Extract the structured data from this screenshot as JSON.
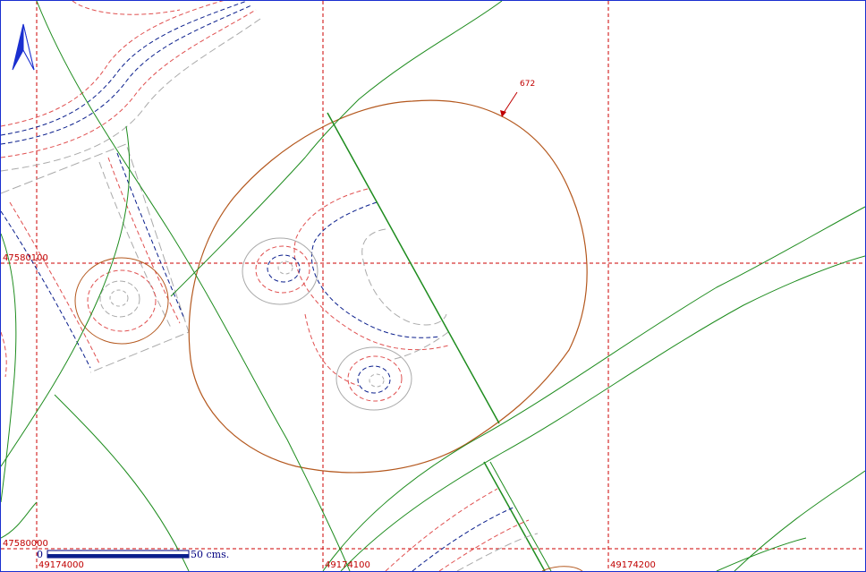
{
  "map": {
    "north_arrow_icon": "north-arrow-icon",
    "grid_labels": {
      "y_upper": "47580100",
      "y_lower": "47580000",
      "x_left": "49174000",
      "x_mid": "49174100",
      "x_right": "49174200"
    },
    "contour_label": "672",
    "scale_bar": {
      "start": "0",
      "end": "50 cms."
    },
    "colors": {
      "frame": "#1a2fd0",
      "grid": "#cc0000",
      "green_lines": "#1e8c1e",
      "brown_contour": "#b4581e",
      "blue_contour": "#0a1e8c",
      "red_dashed": "#e05050",
      "gray_contour": "#aaaaaa"
    }
  }
}
